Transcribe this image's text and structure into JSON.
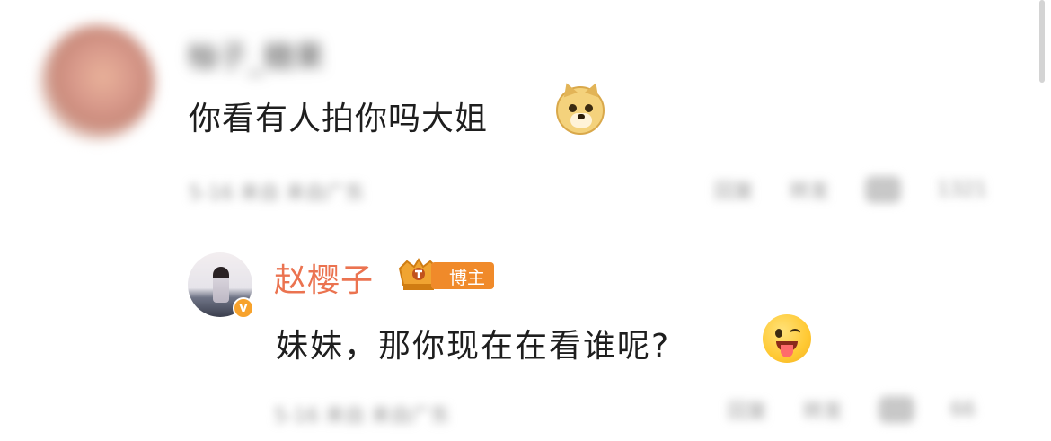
{
  "scrollbar_color": "#d4d4d4",
  "comment": {
    "username": "柚子_糖果",
    "text": "你看有人拍你吗大姐",
    "emoji": "doge-emoji",
    "meta": "5-16 来自 来自广东",
    "actions": {
      "reply_label": "回复",
      "share_label": "转发",
      "like_count": "1321"
    }
  },
  "reply": {
    "username": "赵樱子",
    "name_color": "#eb7350",
    "badge_label": "博主",
    "verified_mark": "v",
    "text": "妹妹，那你现在在看谁呢?",
    "emoji": "tongue-wink-emoji",
    "meta": "5-16 来自 来自广东",
    "actions": {
      "reply_label": "回复",
      "share_label": "转发",
      "like_count": "66"
    }
  }
}
